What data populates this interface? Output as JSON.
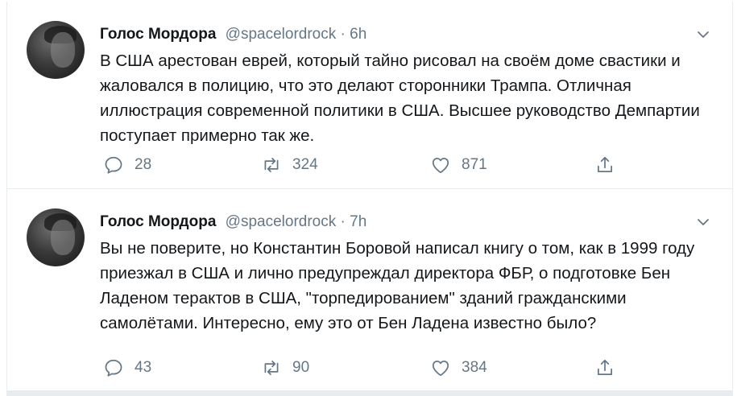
{
  "tweets": [
    {
      "author_name": "Голос Мордора",
      "handle": "@spacelordrock",
      "separator": "·",
      "time": "6h",
      "text": "В США арестован еврей, который тайно рисовал на своём доме свастики и жаловался в полицию, что это делают сторонники Трампа. Отличная иллюстрация современной политики в США. Высшее руководство Демпартии поступает примерно так же.",
      "replies": "28",
      "retweets": "324",
      "likes": "871"
    },
    {
      "author_name": "Голос Мордора",
      "handle": "@spacelordrock",
      "separator": "·",
      "time": "7h",
      "text": "Вы не поверите, но Константин Боровой написал книгу о том, как в 1999 году приезжал в США и лично предупреждал директора ФБР, о подготовке Бен Ладеном терактов в США, \"торпедированием\" зданий гражданскими самолётами. Интересно, ему это от Бен Ладена известно было?",
      "replies": "43",
      "retweets": "90",
      "likes": "384"
    }
  ],
  "icons": [
    "chevron-down-icon",
    "reply-icon",
    "retweet-icon",
    "like-icon",
    "share-icon"
  ],
  "colors": {
    "text": "#14171a",
    "secondary": "#657786",
    "border": "#e6ecf0"
  }
}
